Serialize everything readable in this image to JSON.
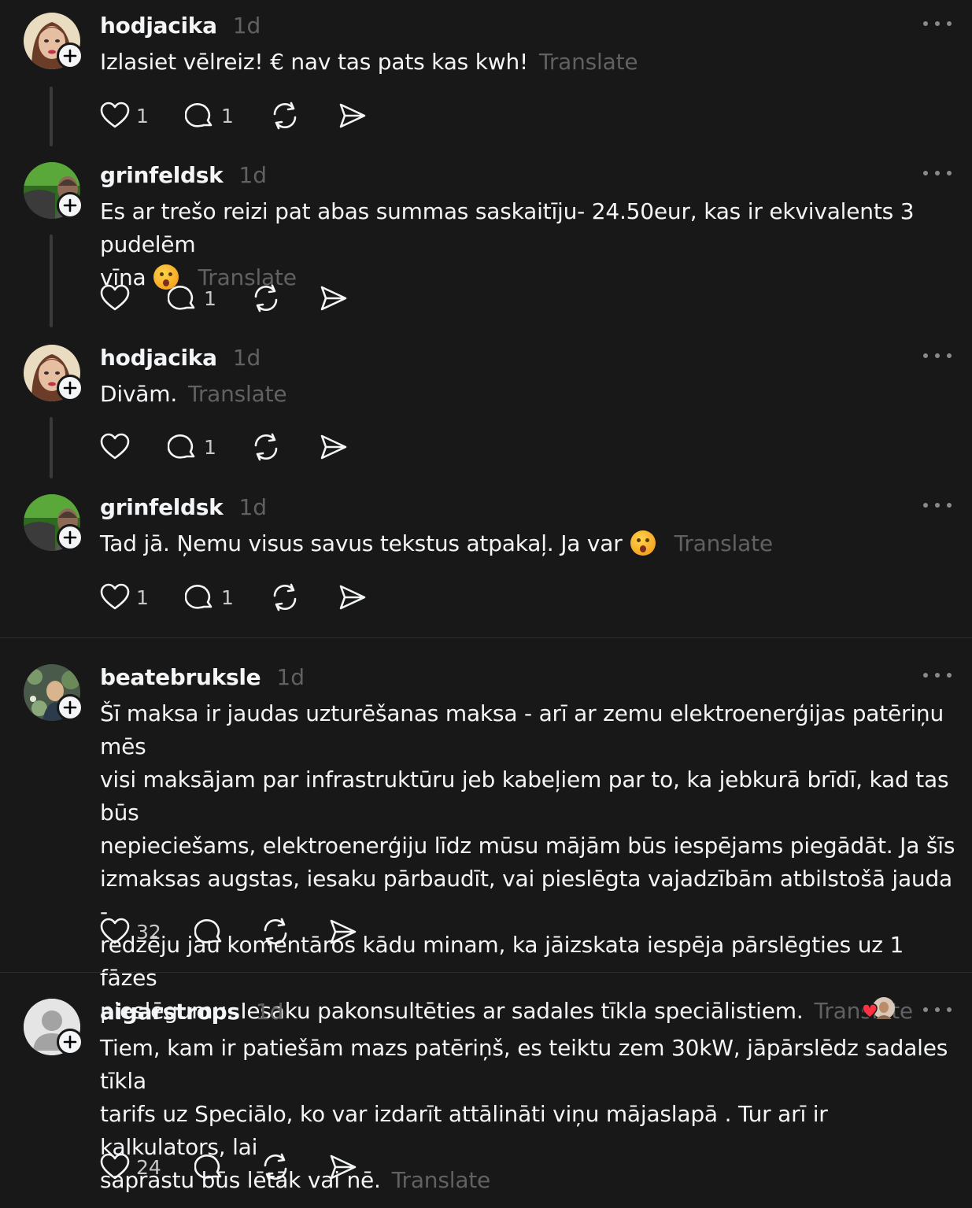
{
  "posts": [
    {
      "username": "hodjacika",
      "time": "1d",
      "text": "Izlasiet vēlreiz! € nav tas pats kas kwh!",
      "translate": "Translate",
      "likes": "1",
      "replies": "1",
      "avatar": "painted-face"
    },
    {
      "username": "grinfeldsk",
      "time": "1d",
      "text_line1": "Es ar trešo reizi pat abas summas saskaitīju- 24.50eur, kas ir ekvivalents 3 pudelēm",
      "text_line2": "vīna",
      "emoji": "face-open-mouth-emoji",
      "translate": "Translate",
      "likes": "",
      "replies": "1",
      "avatar": "car-selfie"
    },
    {
      "username": "hodjacika",
      "time": "1d",
      "text": "Divām.",
      "translate": "Translate",
      "likes": "",
      "replies": "1",
      "avatar": "painted-face"
    },
    {
      "username": "grinfeldsk",
      "time": "1d",
      "text": "Tad jā. Ņemu visus savus tekstus atpakaļ. Ja var",
      "emoji": "face-open-mouth-emoji",
      "translate": "Translate",
      "likes": "1",
      "replies": "1",
      "avatar": "car-selfie"
    },
    {
      "username": "beatebruksle",
      "time": "1d",
      "lines": [
        "Šī maksa ir jaudas uzturēšanas maksa - arī ar zemu elektroenerģijas patēriņu mēs",
        "visi maksājam par infrastruktūru jeb kabeļiem par to, ka jebkurā brīdī, kad tas būs",
        "nepieciešams, elektroenerģiju līdz mūsu mājām būs iespējams piegādāt. Ja šīs",
        "izmaksas augstas, iesaku pārbaudīt, vai pieslēgta vajadzībām atbilstošā jauda -",
        "redzēju jau komentāros kādu minam, ka jāizskata iespēja pārslēgties uz 1 fāzes",
        "pieslēgumu. Iesaku pakonsultēties ar sadales tīkla speciālistiem."
      ],
      "translate": "Translate",
      "likes": "32",
      "replies": "",
      "avatar": "outdoor-portrait"
    },
    {
      "username": "aigarstrops",
      "time": "1d",
      "lines": [
        "Tiem, kam ir patiešām mazs patēriņš, es teiktu zem 30kW, jāpārslēdz sadales tīkla",
        "tarifs uz Speciālo, ko var izdarīt attālināti viņu mājaslapā . Tur arī ir kalkulators, lai",
        "saprastu būs lētāk vai nē."
      ],
      "translate": "Translate",
      "likes": "24",
      "replies": "",
      "avatar": "default-user",
      "liked_by_indicator": "heart-liker-avatar"
    }
  ],
  "colors": {
    "background": "#181818",
    "text": "#f3f5f7",
    "muted": "#616161",
    "like_heart": "#ff3040"
  }
}
